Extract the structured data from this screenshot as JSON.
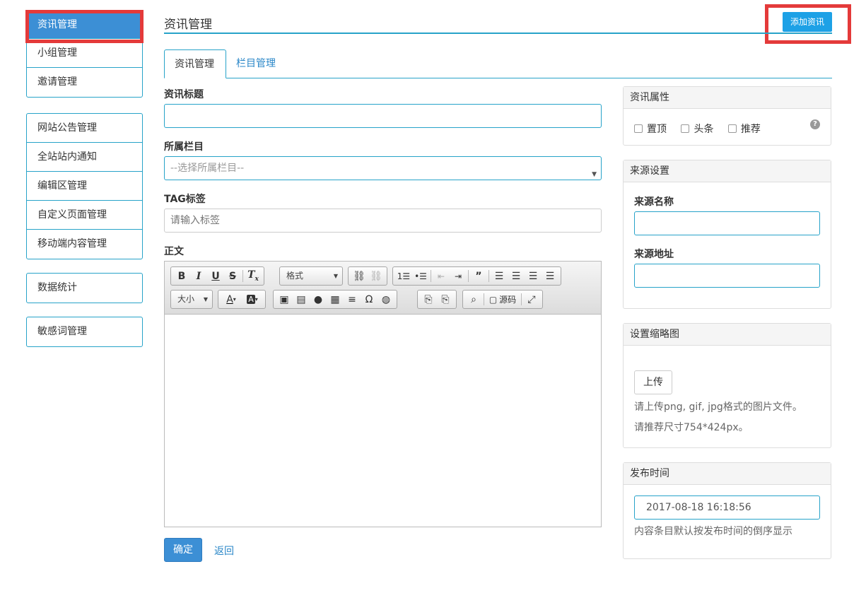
{
  "sidebar": {
    "group1": [
      "资讯管理",
      "小组管理",
      "邀请管理"
    ],
    "group2": [
      "网站公告管理",
      "全站站内通知",
      "编辑区管理",
      "自定义页面管理",
      "移动端内容管理"
    ],
    "group3": [
      "数据统计"
    ],
    "group4": [
      "敏感词管理"
    ]
  },
  "header": {
    "title": "资讯管理",
    "add_button": "添加资讯"
  },
  "tabs": [
    "资讯管理",
    "栏目管理"
  ],
  "form": {
    "title_label": "资讯标题",
    "title_value": "",
    "category_label": "所属栏目",
    "category_selected": "--选择所属栏目--",
    "tag_label": "TAG标签",
    "tag_placeholder": "请输入标签",
    "body_label": "正文"
  },
  "editor": {
    "format_combo": "格式",
    "size_combo": "大小",
    "source_label": "源码",
    "icons": [
      "bold-icon",
      "italic-icon",
      "underline-icon",
      "strikethrough-icon",
      "clear-format-icon",
      "link-icon",
      "unlink-icon",
      "ordered-list-icon",
      "unordered-list-icon",
      "outdent-icon",
      "indent-icon",
      "blockquote-icon",
      "align-left-icon",
      "align-center-icon",
      "align-right-icon",
      "align-justify-icon",
      "text-color-icon",
      "background-color-icon",
      "image-icon",
      "flash-icon",
      "table-icon",
      "horizontal-rule-icon",
      "special-char-icon",
      "iframe-icon",
      "paste-text-icon",
      "paste-word-icon",
      "find-icon",
      "source-icon",
      "maximize-icon"
    ]
  },
  "actions": {
    "confirm": "确定",
    "back": "返回"
  },
  "panels": {
    "attributes": {
      "title": "资讯属性",
      "options": [
        "置顶",
        "头条",
        "推荐"
      ]
    },
    "source": {
      "title": "来源设置",
      "name_label": "来源名称",
      "url_label": "来源地址"
    },
    "thumbnail": {
      "title": "设置缩略图",
      "upload_button": "上传",
      "hint1": "请上传png, gif, jpg格式的图片文件。",
      "hint2": "请推荐尺寸754*424px。"
    },
    "publish": {
      "title": "发布时间",
      "datetime": "2017-08-18 16:18:56",
      "hint": "内容条目默认按发布时间的倒序显示"
    }
  },
  "colors": {
    "accent": "#27a3c9",
    "primary": "#3c8fd5",
    "highlight": "#e43a3a",
    "add_button": "#1da1e6"
  }
}
